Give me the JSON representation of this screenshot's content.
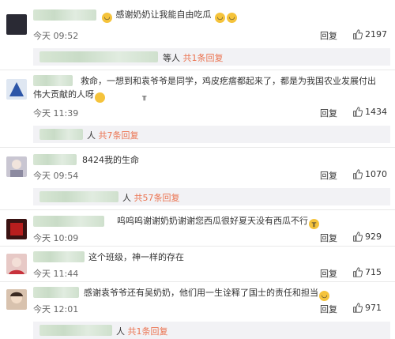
{
  "reply_label": "回复",
  "comments": [
    {
      "text": "感谢奶奶让我能自由吃瓜",
      "time": "今天 09:52",
      "likes": "2197"
    },
    {
      "text": "救命，一想到和袁爷爷是同学，鸡皮疙瘩都起来了，都是为我国农业发展付出伟大贡献的人呀",
      "time": "今天 11:39",
      "likes": "1434"
    },
    {
      "text": "8424我的生命",
      "time": "今天 09:54",
      "likes": "1070"
    },
    {
      "text": "呜呜呜谢谢奶奶谢谢您西瓜很好夏天没有西瓜不行",
      "time": "今天 10:09",
      "likes": "929"
    },
    {
      "text": "这个班级，神一样的存在",
      "time": "今天 11:44",
      "likes": "715"
    },
    {
      "text": "感谢袁爷爷还有吴奶奶，他们用一生诠释了国士的责任和担当",
      "time": "今天 12:01",
      "likes": "971"
    }
  ],
  "subreplies": [
    {
      "suffix": "等人",
      "link": "共1条回复"
    },
    {
      "suffix": "人",
      "link": "共7条回复"
    },
    {
      "suffix": "人",
      "link": "共57条回复"
    },
    {
      "suffix": "人",
      "link": "共1条回复"
    }
  ],
  "icons": {
    "like": "thumbs-up-icon",
    "emoji": "laughing-face-icon",
    "sad": "crying-face-icon"
  }
}
